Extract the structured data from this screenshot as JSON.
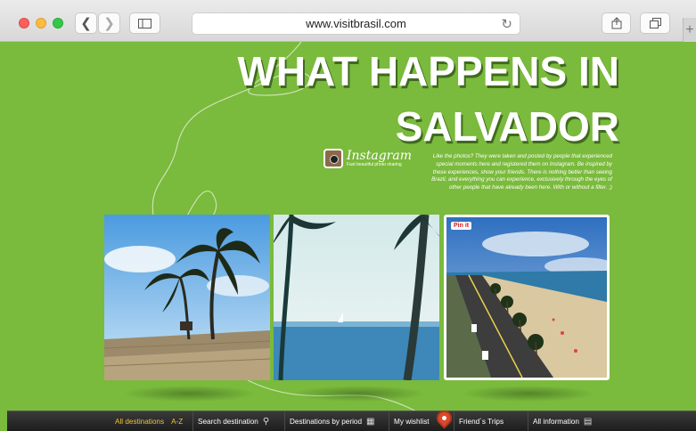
{
  "browser": {
    "url": "www.visitbrasil.com",
    "back_icon": "chevron-left-icon",
    "forward_icon": "chevron-right-icon",
    "sidebar_icon": "sidebar-icon",
    "reload_icon": "reload-icon",
    "share_icon": "share-icon",
    "tabs_icon": "tabs-icon",
    "new_tab_icon": "plus-icon"
  },
  "page": {
    "title_line1": "WHAT HAPPENS IN",
    "title_line2": "SALVADOR",
    "instagram": {
      "name": "Instagram",
      "tagline": "Fast beautiful photo sharing"
    },
    "description": "Like the photos? They were taken and posted by people that experienced special moments here and registered them on Instagram. Be inspired by these experiences, show your friends. There is nothing better than seeing Brazil, and everything you can experience, exclusively through the eyes of other people that have already been here. With or without a filter. ;)",
    "pinit_label": "Pin it"
  },
  "nav": {
    "all_destinations": "All destinations",
    "az": "A-Z",
    "search_destination": "Search destination",
    "destinations_by_period": "Destinations by period",
    "my_wishlist": "My wishlist",
    "friends_trips": "Friend´s Trips",
    "all_information": "All information"
  },
  "colors": {
    "page_bg": "#7aba3c",
    "nav_bg": "#262626",
    "nav_highlight": "#f2c230",
    "pin": "#d84a2c"
  }
}
